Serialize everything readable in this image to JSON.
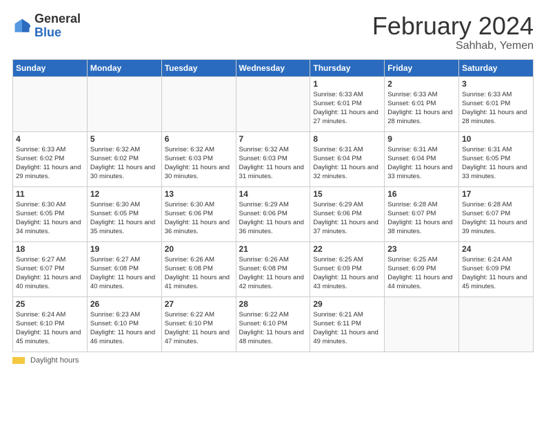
{
  "header": {
    "logo_general": "General",
    "logo_blue": "Blue",
    "month_year": "February 2024",
    "location": "Sahhab, Yemen"
  },
  "days_of_week": [
    "Sunday",
    "Monday",
    "Tuesday",
    "Wednesday",
    "Thursday",
    "Friday",
    "Saturday"
  ],
  "weeks": [
    [
      {
        "day": "",
        "info": ""
      },
      {
        "day": "",
        "info": ""
      },
      {
        "day": "",
        "info": ""
      },
      {
        "day": "",
        "info": ""
      },
      {
        "day": "1",
        "info": "Sunrise: 6:33 AM\nSunset: 6:01 PM\nDaylight: 11 hours and 27 minutes."
      },
      {
        "day": "2",
        "info": "Sunrise: 6:33 AM\nSunset: 6:01 PM\nDaylight: 11 hours and 28 minutes."
      },
      {
        "day": "3",
        "info": "Sunrise: 6:33 AM\nSunset: 6:01 PM\nDaylight: 11 hours and 28 minutes."
      }
    ],
    [
      {
        "day": "4",
        "info": "Sunrise: 6:33 AM\nSunset: 6:02 PM\nDaylight: 11 hours and 29 minutes."
      },
      {
        "day": "5",
        "info": "Sunrise: 6:32 AM\nSunset: 6:02 PM\nDaylight: 11 hours and 30 minutes."
      },
      {
        "day": "6",
        "info": "Sunrise: 6:32 AM\nSunset: 6:03 PM\nDaylight: 11 hours and 30 minutes."
      },
      {
        "day": "7",
        "info": "Sunrise: 6:32 AM\nSunset: 6:03 PM\nDaylight: 11 hours and 31 minutes."
      },
      {
        "day": "8",
        "info": "Sunrise: 6:31 AM\nSunset: 6:04 PM\nDaylight: 11 hours and 32 minutes."
      },
      {
        "day": "9",
        "info": "Sunrise: 6:31 AM\nSunset: 6:04 PM\nDaylight: 11 hours and 33 minutes."
      },
      {
        "day": "10",
        "info": "Sunrise: 6:31 AM\nSunset: 6:05 PM\nDaylight: 11 hours and 33 minutes."
      }
    ],
    [
      {
        "day": "11",
        "info": "Sunrise: 6:30 AM\nSunset: 6:05 PM\nDaylight: 11 hours and 34 minutes."
      },
      {
        "day": "12",
        "info": "Sunrise: 6:30 AM\nSunset: 6:05 PM\nDaylight: 11 hours and 35 minutes."
      },
      {
        "day": "13",
        "info": "Sunrise: 6:30 AM\nSunset: 6:06 PM\nDaylight: 11 hours and 36 minutes."
      },
      {
        "day": "14",
        "info": "Sunrise: 6:29 AM\nSunset: 6:06 PM\nDaylight: 11 hours and 36 minutes."
      },
      {
        "day": "15",
        "info": "Sunrise: 6:29 AM\nSunset: 6:06 PM\nDaylight: 11 hours and 37 minutes."
      },
      {
        "day": "16",
        "info": "Sunrise: 6:28 AM\nSunset: 6:07 PM\nDaylight: 11 hours and 38 minutes."
      },
      {
        "day": "17",
        "info": "Sunrise: 6:28 AM\nSunset: 6:07 PM\nDaylight: 11 hours and 39 minutes."
      }
    ],
    [
      {
        "day": "18",
        "info": "Sunrise: 6:27 AM\nSunset: 6:07 PM\nDaylight: 11 hours and 40 minutes."
      },
      {
        "day": "19",
        "info": "Sunrise: 6:27 AM\nSunset: 6:08 PM\nDaylight: 11 hours and 40 minutes."
      },
      {
        "day": "20",
        "info": "Sunrise: 6:26 AM\nSunset: 6:08 PM\nDaylight: 11 hours and 41 minutes."
      },
      {
        "day": "21",
        "info": "Sunrise: 6:26 AM\nSunset: 6:08 PM\nDaylight: 11 hours and 42 minutes."
      },
      {
        "day": "22",
        "info": "Sunrise: 6:25 AM\nSunset: 6:09 PM\nDaylight: 11 hours and 43 minutes."
      },
      {
        "day": "23",
        "info": "Sunrise: 6:25 AM\nSunset: 6:09 PM\nDaylight: 11 hours and 44 minutes."
      },
      {
        "day": "24",
        "info": "Sunrise: 6:24 AM\nSunset: 6:09 PM\nDaylight: 11 hours and 45 minutes."
      }
    ],
    [
      {
        "day": "25",
        "info": "Sunrise: 6:24 AM\nSunset: 6:10 PM\nDaylight: 11 hours and 45 minutes."
      },
      {
        "day": "26",
        "info": "Sunrise: 6:23 AM\nSunset: 6:10 PM\nDaylight: 11 hours and 46 minutes."
      },
      {
        "day": "27",
        "info": "Sunrise: 6:22 AM\nSunset: 6:10 PM\nDaylight: 11 hours and 47 minutes."
      },
      {
        "day": "28",
        "info": "Sunrise: 6:22 AM\nSunset: 6:10 PM\nDaylight: 11 hours and 48 minutes."
      },
      {
        "day": "29",
        "info": "Sunrise: 6:21 AM\nSunset: 6:11 PM\nDaylight: 11 hours and 49 minutes."
      },
      {
        "day": "",
        "info": ""
      },
      {
        "day": "",
        "info": ""
      }
    ]
  ],
  "footer": {
    "daylight_label": "Daylight hours"
  }
}
